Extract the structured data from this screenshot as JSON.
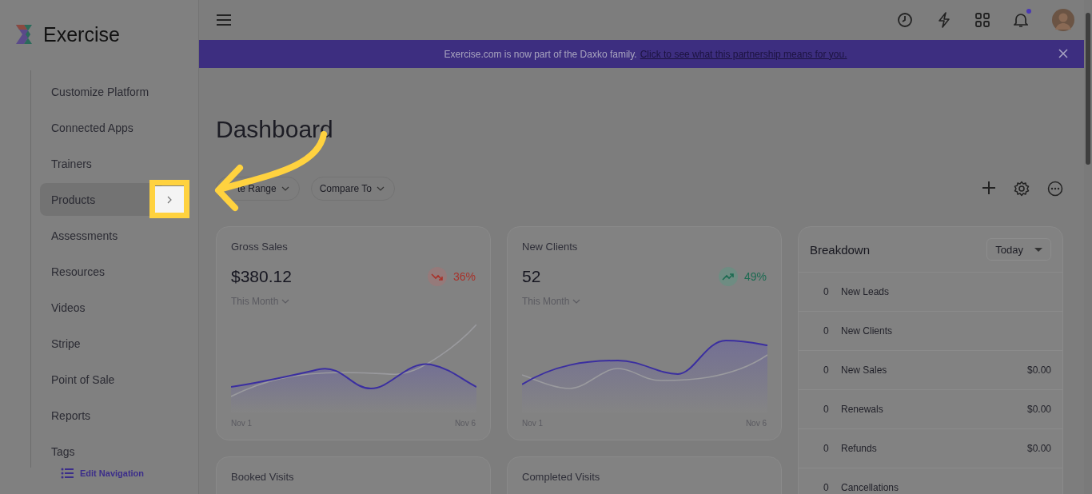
{
  "app": {
    "name": "Exercise"
  },
  "sidebar": {
    "items": [
      {
        "label": "Customize Platform",
        "selected": false
      },
      {
        "label": "Connected Apps",
        "selected": false
      },
      {
        "label": "Trainers",
        "selected": false
      },
      {
        "label": "Products",
        "selected": true
      },
      {
        "label": "Assessments",
        "selected": false
      },
      {
        "label": "Resources",
        "selected": false
      },
      {
        "label": "Videos",
        "selected": false
      },
      {
        "label": "Stripe",
        "selected": false
      },
      {
        "label": "Point of Sale",
        "selected": false
      },
      {
        "label": "Reports",
        "selected": false
      },
      {
        "label": "Tags",
        "selected": false
      }
    ],
    "edit_navigation": "Edit Navigation"
  },
  "topbar": {
    "notifications_unread": true
  },
  "banner": {
    "text": "Exercise.com is now part of the Daxko family.",
    "link": "Click to see what this partnership means for you."
  },
  "page_title": "Dashboard",
  "filters": [
    "te Range",
    "Compare To"
  ],
  "stat_cards": [
    {
      "title": "Gross Sales",
      "value": "$380.12",
      "change": "36%",
      "kind": "down",
      "period": "This Month",
      "x_start": "Nov 1",
      "x_end": "Nov 6"
    },
    {
      "title": "New Clients",
      "value": "52",
      "change": "49%",
      "kind": "up",
      "period": "This Month",
      "x_start": "Nov 1",
      "x_end": "Nov 6"
    }
  ],
  "breakdown": {
    "title": "Breakdown",
    "period": "Today",
    "rows": [
      {
        "count": "0",
        "label": "New Leads"
      },
      {
        "count": "0",
        "label": "New Clients"
      },
      {
        "count": "0",
        "label": "New Sales",
        "amount": "$0.00"
      },
      {
        "count": "0",
        "label": "Renewals",
        "amount": "$0.00"
      },
      {
        "count": "0",
        "label": "Refunds",
        "amount": "$0.00"
      },
      {
        "count": "0",
        "label": "Cancellations"
      }
    ]
  },
  "lower_cards": [
    "Booked Visits",
    "Completed Visits"
  ]
}
